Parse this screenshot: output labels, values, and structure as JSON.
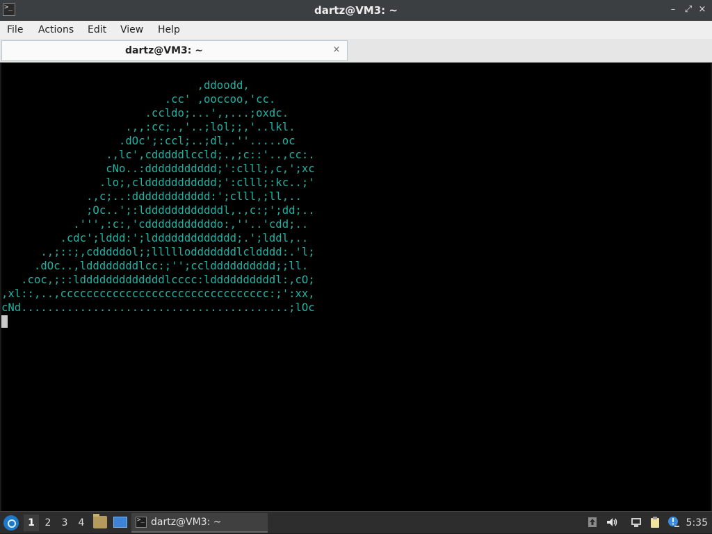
{
  "window": {
    "title": "dartz@VM3: ~",
    "controls": {
      "minimize": "–",
      "maximize": "⤢",
      "close": "×"
    }
  },
  "menu": [
    "File",
    "Actions",
    "Edit",
    "View",
    "Help"
  ],
  "tab": {
    "title": "dartz@VM3: ~",
    "close": "×"
  },
  "terminal": {
    "text_color": "#20b3a3",
    "background": "#000000",
    "lines": [
      "                              ,ddoodd,",
      "                         .cc' ,ooccoo,'cc.",
      "                      .ccldo;...',,...;oxdc.",
      "                   .,,:cc;.,'..;lol;;,'..lkl.",
      "                  .dOc';:ccl;..;dl,.''.....oc",
      "                .,lc',cdddddlccld;.,;c::'..,cc:.",
      "                cNo..:ddddddddddd;':clll;,c,';xc",
      "               .lo;,clddddddddddd;':clll;:kc..;'",
      "             .,c;..:dddddddddddd:';clll,;ll,..",
      "             ;Oc..';:lddddddddddddl,.,c:;';dd;..",
      "           .''',:c:,'cdddddddddddo:,''..'cdd;..",
      "         .cdc';lddd:';lddddddddddddd;.';lddl,..",
      "      .,;::;,cdddddol;;lllllodddddddlcldddd:.'l;",
      "     .dOc..,lddddddddlcc:;'';ccldddddddddd;;ll.",
      "   .coc,;::ldddddddddddddlcccc:lddddddddddl:,cO;",
      ",xl::,..,cccccccccccccccccccccccccccccccc:;':xx,",
      "cNd.........................................;lOc"
    ]
  },
  "taskbar": {
    "workspaces": [
      "1",
      "2",
      "3",
      "4"
    ],
    "active_workspace": "1",
    "task_label": "dartz@VM3: ~",
    "clock": "5:35",
    "tray_icons": [
      "upload-arrow-icon",
      "volume-icon",
      "network-icon",
      "clipboard-icon",
      "notification-icon"
    ]
  }
}
